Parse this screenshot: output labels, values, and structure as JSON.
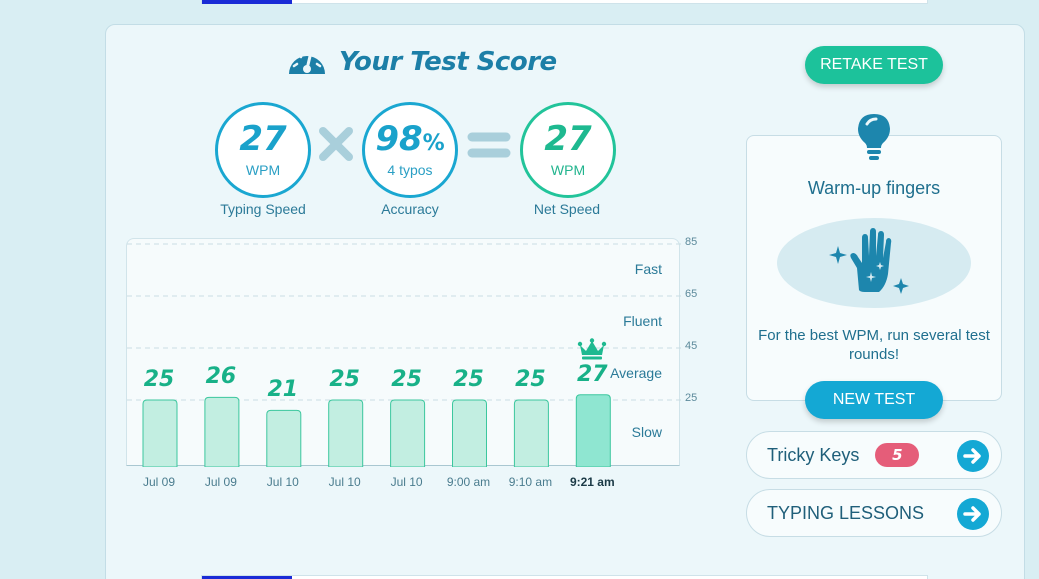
{
  "header": {
    "title": "Your Test Score",
    "retake_label": "RETAKE TEST"
  },
  "metrics": {
    "typing_speed": {
      "value": "27",
      "unit": "WPM",
      "label": "Typing Speed"
    },
    "accuracy": {
      "value": "98",
      "percent_sign": "%",
      "sub": "4 typos",
      "label": "Accuracy"
    },
    "net_speed": {
      "value": "27",
      "unit": "WPM",
      "label": "Net Speed"
    }
  },
  "chart_data": {
    "type": "bar",
    "categories": [
      "Jul 09",
      "Jul 09",
      "Jul 10",
      "Jul 10",
      "Jul 10",
      "9:00 am",
      "9:10 am",
      "9:21 am"
    ],
    "values": [
      25,
      26,
      21,
      25,
      25,
      25,
      25,
      27
    ],
    "value_labels": [
      "25",
      "26",
      "21",
      "25",
      "25",
      "25",
      "25",
      "27"
    ],
    "current_index": 7,
    "ylim": [
      0,
      85
    ],
    "yticks": [
      "85",
      "65",
      "45",
      "25"
    ],
    "zones": [
      "Fast",
      "Fluent",
      "Average",
      "Slow"
    ],
    "colors": {
      "bar": "#c2eee1",
      "bar_current": "#8fe6d1",
      "bar_stroke": "#3cc79e"
    }
  },
  "warmup": {
    "title": "Warm-up fingers",
    "text": "For the best WPM, run several test rounds!",
    "new_test_label": "NEW TEST"
  },
  "side": {
    "tricky_keys_label": "Tricky Keys",
    "tricky_keys_count": "5",
    "lessons_label": "TYPING LESSONS"
  },
  "colors": {
    "accent_blue": "#14a8d4",
    "accent_green": "#1cc29b",
    "badge_pink": "#e55d79"
  }
}
